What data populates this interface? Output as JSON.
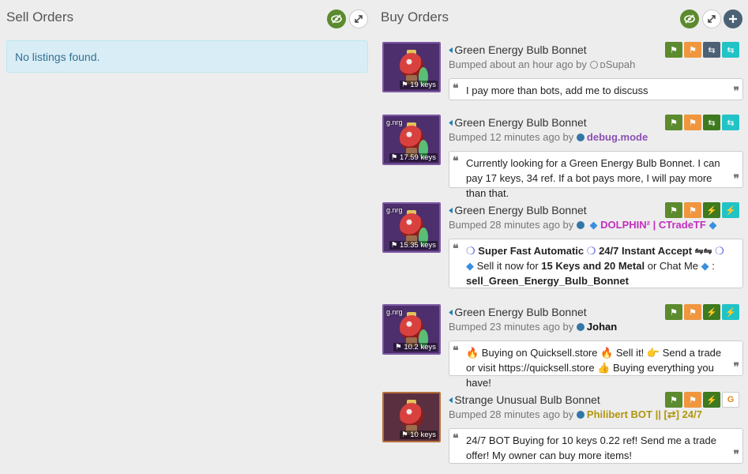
{
  "sell": {
    "title": "Sell Orders",
    "empty_msg": "No listings found."
  },
  "buy": {
    "title": "Buy Orders"
  },
  "controls": {
    "toggle_icon": "eye-slash-icon",
    "expand_icon": "expand-icon",
    "add_icon": "plus-icon"
  },
  "listings": [
    {
      "item": "Green Energy Bulb Bonnet",
      "tag": "",
      "price": "19 keys",
      "bumped": "Bumped about an hour ago by",
      "user": "ᴅSupah",
      "message": "I pay more than bots, add me to discuss"
    },
    {
      "item": "Green Energy Bulb Bonnet",
      "tag": "g.nrg",
      "price": "17.59 keys",
      "bumped": "Bumped 12 minutes ago by",
      "user": "debug.mode",
      "message": "Currently looking for a Green Energy Bulb Bonnet. I can pay 17 keys, 34 ref. If a bot pays more, I will pay more than that."
    },
    {
      "item": "Green Energy Bulb Bonnet",
      "tag": "g.nrg",
      "price": "15.35 keys",
      "bumped": "Bumped 28 minutes ago by",
      "user": "DOLPHIN² | CTradeTF",
      "msg_a": "Super Fast Automatic",
      "msg_b": "24/7 Instant Accept ⇋⇋",
      "msg_c": "Sell it now for",
      "msg_d": "15 Keys and 20 Metal",
      "msg_e": "or Chat Me",
      "msg_f": ":",
      "msg_g": "sell_Green_Energy_Bulb_Bonnet"
    },
    {
      "item": "Green Energy Bulb Bonnet",
      "tag": "g.nrg",
      "price": "10.2 keys",
      "bumped": "Bumped 23 minutes ago by",
      "user": "Johan",
      "message": "🔥 Buying on Quicksell.store 🔥  Sell it!  👉  Send a trade or visit https://quicksell.store  👍  Buying everything you have!"
    },
    {
      "item": "Strange Unusual Bulb Bonnet",
      "tag": "",
      "price": "10 keys",
      "bumped": "Bumped 28 minutes ago by",
      "user": "Philibert BOT || [⇄] 24/7",
      "message": "24/7 BOT Buying for 10 keys 0.22 ref! Send me a trade offer! My owner can buy more items!"
    }
  ]
}
